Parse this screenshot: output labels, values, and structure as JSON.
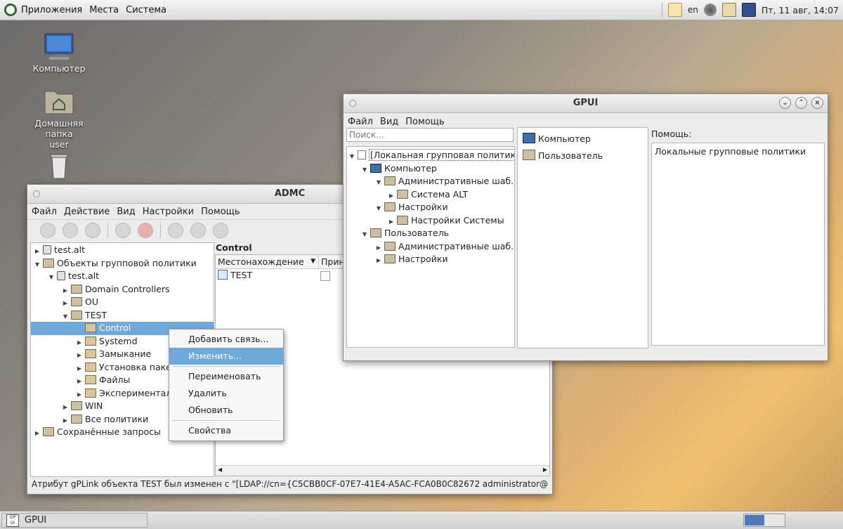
{
  "top_panel": {
    "menus": [
      "Приложения",
      "Места",
      "Система"
    ],
    "lang": "en",
    "clock": "Пт, 11 авг, 14:07"
  },
  "desktop": {
    "computer": "Компьютер",
    "home_line1": "Домашняя папка",
    "home_line2": "user"
  },
  "admc": {
    "title": "ADMC",
    "menu": [
      "Файл",
      "Действие",
      "Вид",
      "Настройки",
      "Помощь"
    ],
    "tree": {
      "domain": "test.alt",
      "gpo_container": "Объекты групповой политики",
      "gpo_domain": "test.alt",
      "domain_controllers": "Domain Controllers",
      "ou": "OU",
      "test": "TEST",
      "control": "Control",
      "systemd": "Systemd",
      "zamykanie": "Замыкание",
      "install": "Установка пакет",
      "files": "Файлы",
      "experimental": "Экспериментал",
      "win": "WIN",
      "all_policies": "Все политики",
      "saved_queries": "Сохранённые запросы"
    },
    "right": {
      "header": "Control",
      "col_location": "Местонахождение",
      "col_enforced": "Прину",
      "row_location": "TEST"
    },
    "status": "Атрибут gPLink объекта TEST был изменен с \"[LDAP://cn={C5CBB0CF-07E7-41E4-A5AC-FCA0B0C82672 administrator@test.alt"
  },
  "context_menu": {
    "add_link": "Добавить связь...",
    "edit": "Изменить...",
    "rename": "Переименовать",
    "delete": "Удалить",
    "refresh": "Обновить",
    "properties": "Свойства"
  },
  "gpui": {
    "title": "GPUI",
    "menu": [
      "Файл",
      "Вид",
      "Помощь"
    ],
    "search_placeholder": "Поиск...",
    "tree": {
      "root": "[Локальная групповая политика]",
      "computer": "Компьютер",
      "admin_templates_c": "Административные шаб...",
      "system_alt": "Система ALT",
      "settings_c": "Настройки",
      "system_settings": "Настройки Системы",
      "user": "Пользователь",
      "admin_templates_u": "Административные шаб...",
      "settings_u": "Настройки"
    },
    "middle": {
      "computer": "Компьютер",
      "user": "Пользователь"
    },
    "help_label": "Помощь:",
    "help_text": "Локальные групповые политики"
  },
  "taskbar": {
    "task": "GPUI"
  }
}
